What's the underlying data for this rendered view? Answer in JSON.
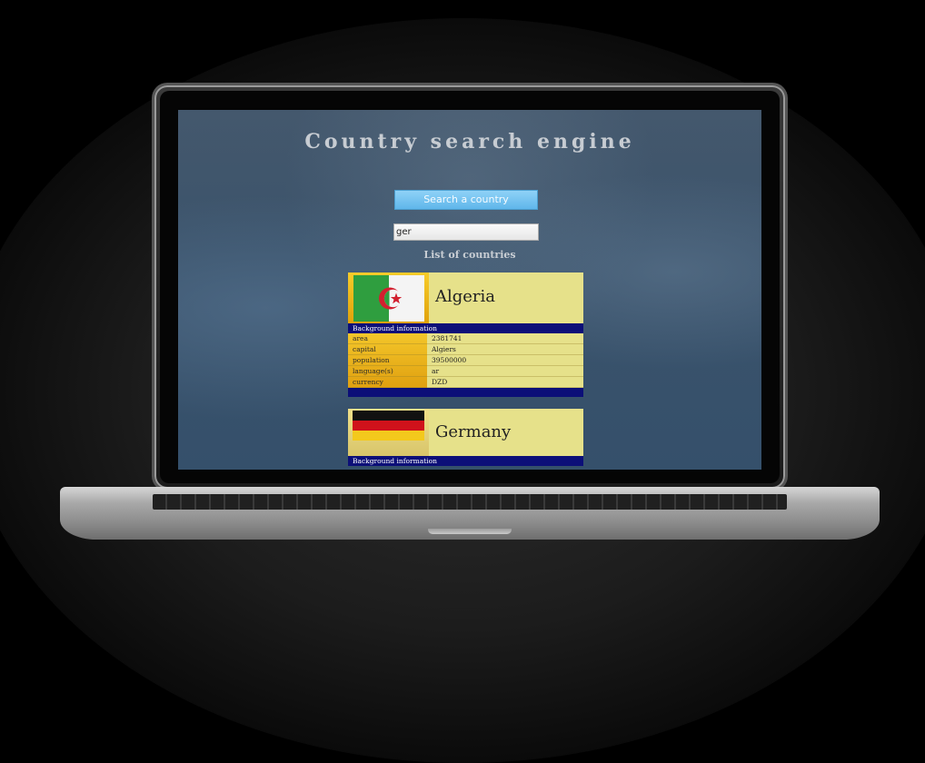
{
  "app": {
    "title": "Country search engine",
    "search_button_label": "Search a country",
    "search_input_value": "ger",
    "list_heading": "List of countries"
  },
  "countries": [
    {
      "name": "Algeria",
      "flag_icon": "algeria-flag-icon",
      "background_label": "Background information",
      "fields": [
        {
          "key": "area",
          "value": "2381741"
        },
        {
          "key": "capital",
          "value": "Algiers"
        },
        {
          "key": "population",
          "value": "39500000"
        },
        {
          "key": "language(s)",
          "value": "ar"
        },
        {
          "key": "currency",
          "value": "DZD"
        }
      ]
    },
    {
      "name": "Germany",
      "flag_icon": "germany-flag-icon",
      "background_label": "Background information"
    }
  ],
  "colors": {
    "screen_bg": "#3b536b",
    "card_bg": "#e6e18a",
    "bar_bg": "#0c0f78",
    "button_bg": "#5fb6ea"
  }
}
